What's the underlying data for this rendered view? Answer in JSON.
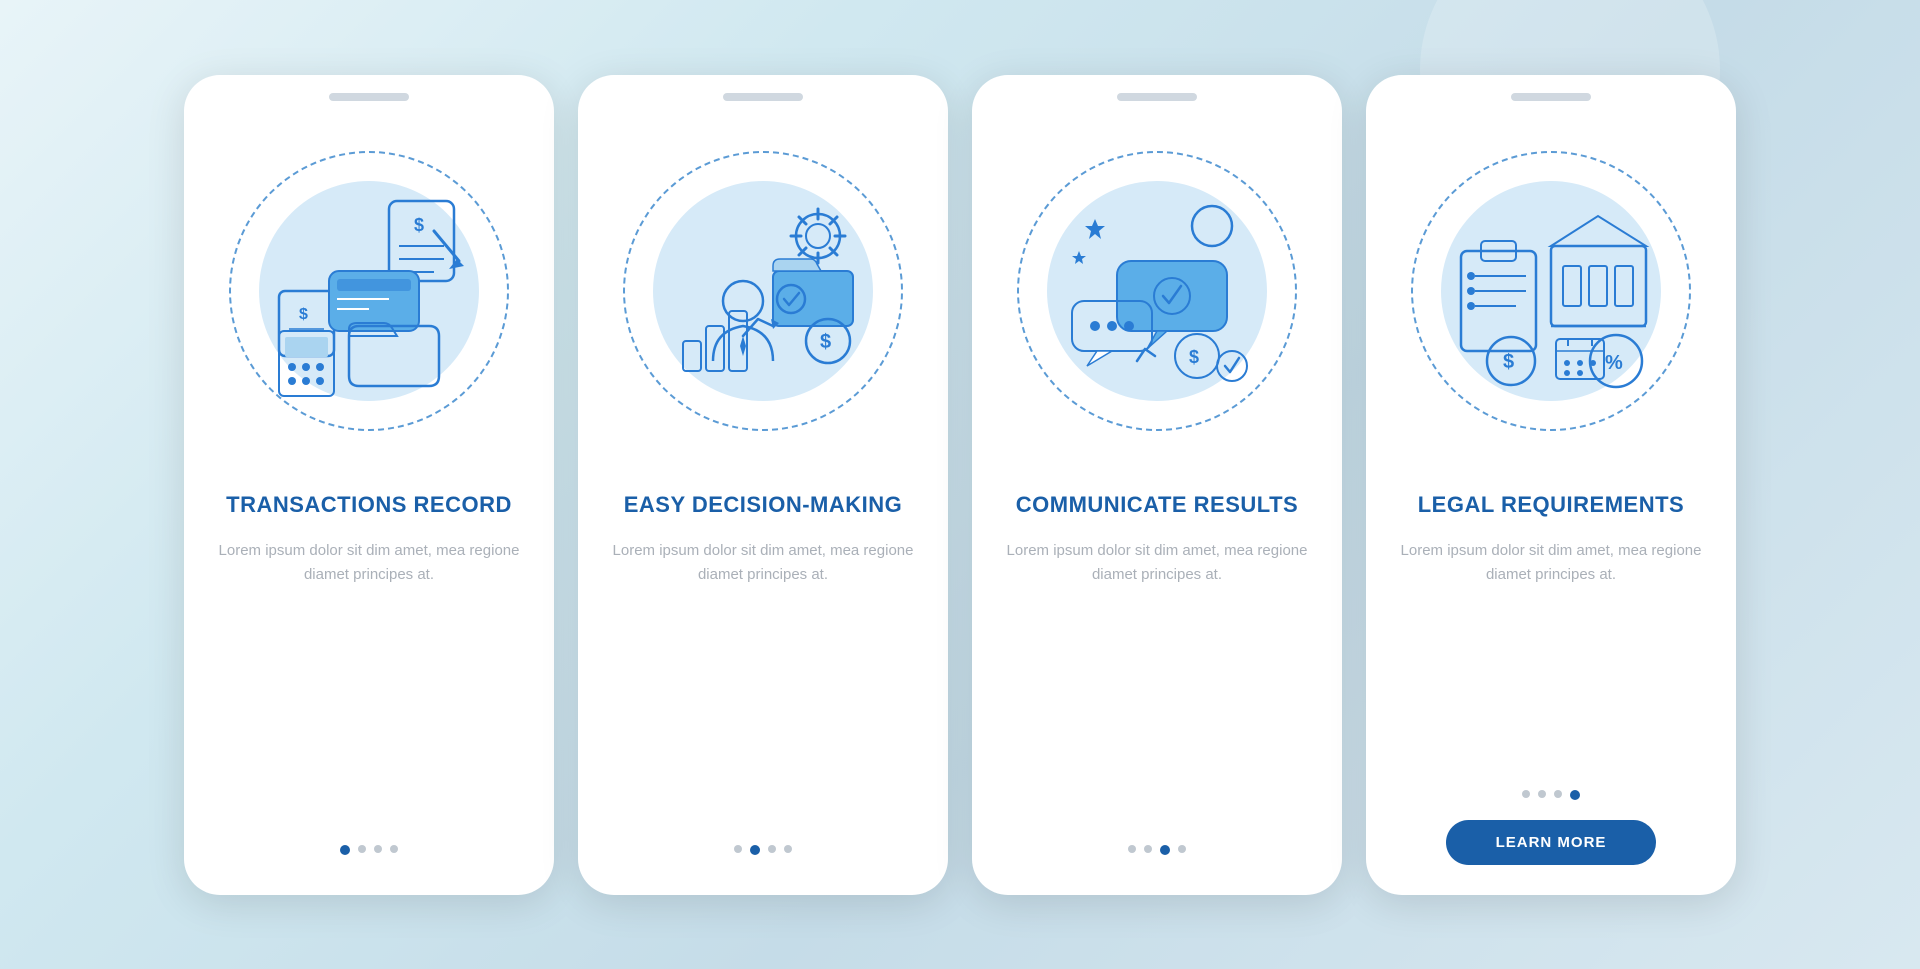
{
  "background": {
    "color1": "#e8f4f8",
    "color2": "#c5dce8"
  },
  "cards": [
    {
      "id": "transactions-record",
      "title": "TRANSACTIONS\nRECORD",
      "description": "Lorem ipsum dolor sit dim amet, mea regione diamet principes at.",
      "dots": [
        true,
        false,
        false,
        false
      ],
      "has_button": false,
      "button_label": ""
    },
    {
      "id": "easy-decision-making",
      "title": "EASY\nDECISION-MAKING",
      "description": "Lorem ipsum dolor sit dim amet, mea regione diamet principes at.",
      "dots": [
        false,
        true,
        false,
        false
      ],
      "has_button": false,
      "button_label": ""
    },
    {
      "id": "communicate-results",
      "title": "COMMUNICATE\nRESULTS",
      "description": "Lorem ipsum dolor sit dim amet, mea regione diamet principes at.",
      "dots": [
        false,
        false,
        true,
        false
      ],
      "has_button": false,
      "button_label": ""
    },
    {
      "id": "legal-requirements",
      "title": "LEGAL\nREQUIREMENTS",
      "description": "Lorem ipsum dolor sit dim amet, mea regione diamet principes at.",
      "dots": [
        false,
        false,
        false,
        true
      ],
      "has_button": true,
      "button_label": "LEARN MORE"
    }
  ]
}
